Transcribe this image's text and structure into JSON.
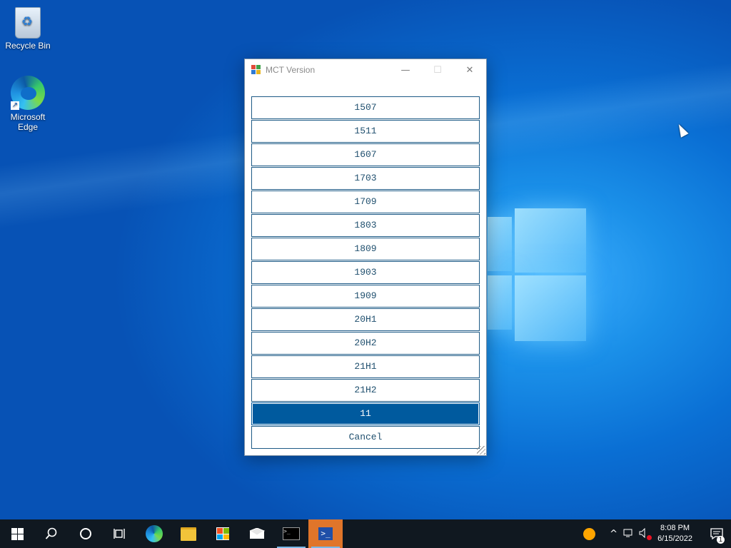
{
  "desktop": {
    "icons": [
      {
        "label": "Recycle Bin",
        "icon": "recycle-bin-icon"
      },
      {
        "label": "Microsoft\nEdge",
        "icon": "edge-icon"
      }
    ]
  },
  "window": {
    "title": "MCT Version",
    "controls": {
      "minimize": "—",
      "maximize": "☐",
      "close": "✕"
    },
    "versions": [
      "1507",
      "1511",
      "1607",
      "1703",
      "1709",
      "1803",
      "1809",
      "1903",
      "1909",
      "20H1",
      "20H2",
      "21H1",
      "21H2",
      "11"
    ],
    "selected": "11",
    "cancel_label": "Cancel"
  },
  "taskbar": {
    "items": [
      "start-icon",
      "search-icon",
      "cortana-icon",
      "task-view-icon",
      "edge-icon",
      "file-explorer-icon",
      "store-icon",
      "mail-icon",
      "cmd-icon",
      "powershell-icon"
    ],
    "clock": {
      "time": "8:08 PM",
      "date": "6/15/2022"
    },
    "notification_count": "1"
  },
  "colors": {
    "accent": "#005a9e",
    "button_border": "#1d5a86",
    "taskbar": "#101820"
  }
}
